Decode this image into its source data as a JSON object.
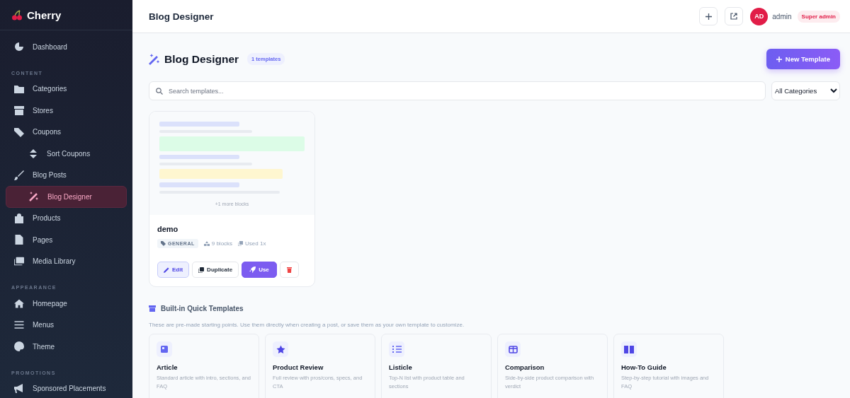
{
  "app": {
    "name": "Cherry"
  },
  "sidebar": {
    "sections": [
      {
        "items": [
          {
            "label": "Dashboard",
            "selected": false
          }
        ]
      },
      {
        "heading": "CONTENT",
        "items": [
          {
            "label": "Categories",
            "selected": false
          },
          {
            "label": "Stores",
            "selected": false
          },
          {
            "label": "Coupons",
            "selected": false,
            "children": [
              {
                "label": "Sort Coupons",
                "selected": false
              }
            ]
          },
          {
            "label": "Blog Posts",
            "selected": false,
            "children": [
              {
                "label": "Blog Designer",
                "selected": true
              }
            ]
          },
          {
            "label": "Products",
            "selected": false
          },
          {
            "label": "Pages",
            "selected": false
          },
          {
            "label": "Media Library",
            "selected": false
          }
        ]
      },
      {
        "heading": "APPEARANCE",
        "items": [
          {
            "label": "Homepage",
            "selected": false
          },
          {
            "label": "Menus",
            "selected": false
          },
          {
            "label": "Theme",
            "selected": false
          }
        ]
      },
      {
        "heading": "PROMOTIONS",
        "items": [
          {
            "label": "Sponsored Placements",
            "selected": false
          }
        ]
      }
    ]
  },
  "topbar": {
    "title": "Blog Designer",
    "user": {
      "initials": "AD",
      "name": "admin",
      "role": "Super admin"
    }
  },
  "page": {
    "title": "Blog Designer",
    "count": "1 templates",
    "new_button": "New Template",
    "search": {
      "placeholder": "Search templates..."
    },
    "category_filter": {
      "value": "All Categories"
    }
  },
  "templates": [
    {
      "name": "demo",
      "more": "+1 more blocks",
      "category": "GENERAL",
      "blocks": "9 blocks",
      "used": "Used 1x",
      "actions": [
        "Edit",
        "Duplicate",
        "Use"
      ]
    }
  ],
  "quick": {
    "title": "Built-in Quick Templates",
    "description": "These are pre-made starting points. Use them directly when creating a post, or save them as your own template to customize.",
    "items": [
      {
        "kind": "article",
        "title": "Article",
        "description": "Standard article with intro, sections, and FAQ"
      },
      {
        "kind": "review",
        "title": "Product Review",
        "description": "Full review with pros/cons, specs, and CTA"
      },
      {
        "kind": "listicle",
        "title": "Listicle",
        "description": "Top-N list with product table and sections"
      },
      {
        "kind": "comparison",
        "title": "Comparison",
        "description": "Side-by-side product comparison with verdict"
      },
      {
        "kind": "guide",
        "title": "How-To Guide",
        "description": "Step-by-step tutorial with images and FAQ"
      }
    ]
  }
}
